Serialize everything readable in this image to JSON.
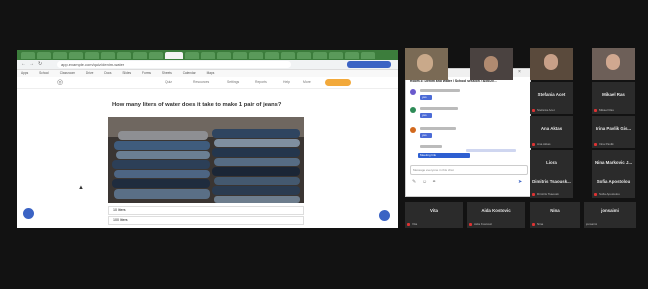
{
  "browser": {
    "url": "app.example.com/quiz/denim-water",
    "bookmarks": [
      "Apps",
      "School",
      "Classroom",
      "Drive",
      "Docs",
      "Slides",
      "Forms",
      "Sheets",
      "Calendar",
      "Maps"
    ],
    "nav_links": [
      "Quiz",
      "Resources",
      "Settings",
      "Reports",
      "Help",
      "More"
    ],
    "cta_label": ""
  },
  "quiz": {
    "question": "How many liters of water does it take to make 1 pair of jeans?",
    "answers": [
      "10 liters",
      "100 liters"
    ]
  },
  "chat": {
    "title": "Meeting chat",
    "subtitle": "Room 3: Denim and Water / School session / 8/26/20...",
    "bubbles": [
      "yes",
      "yes",
      "yes"
    ],
    "typed_message": "Meeting link",
    "input_placeholder": "Message everyone in this chat"
  },
  "participants": [
    {
      "name": "",
      "sub": "",
      "video": true,
      "muted": false
    },
    {
      "name": "",
      "sub": "",
      "video": true,
      "muted": false
    },
    {
      "name": "",
      "sub": "",
      "video": true,
      "muted": false
    },
    {
      "name": "",
      "sub": "",
      "video": true,
      "muted": false
    },
    {
      "name": "Stefania Acet",
      "sub": "Stefania Acet",
      "video": false,
      "muted": true
    },
    {
      "name": "Mikael Ras",
      "sub": "Mikael Ras",
      "video": false,
      "muted": true
    },
    {
      "name": "Ana Aktas",
      "sub": "Ana Aktas",
      "video": false,
      "muted": true
    },
    {
      "name": "Irina Pavlik Gis...",
      "sub": "Irina Pavlik",
      "video": false,
      "muted": true
    },
    {
      "name": "Liora",
      "sub": "Liora",
      "video": false,
      "muted": true
    },
    {
      "name": "Nina Markovic J...",
      "sub": "Nina Markovic",
      "video": false,
      "muted": true
    },
    {
      "name": "Dimitris Tsaousk...",
      "sub": "Dimitris Tsaousk",
      "video": false,
      "muted": true
    },
    {
      "name": "Sofia Apostolou",
      "sub": "Sofia Apostolou",
      "video": false,
      "muted": true
    },
    {
      "name": "Vita",
      "sub": "Vita",
      "video": false,
      "muted": true
    },
    {
      "name": "Aida Kostovic",
      "sub": "Aida Kostovic",
      "video": false,
      "muted": true
    },
    {
      "name": "Nina",
      "sub": "Nina",
      "video": false,
      "muted": true
    },
    {
      "name": "jonsaimi",
      "sub": "jonsaimi",
      "video": false,
      "muted": true
    }
  ],
  "colors": {
    "background": "#121212",
    "tab_bar": "#3c7d3c",
    "tile_bg": "#2b2b2b",
    "accent_blue": "#3b63c4",
    "cta_orange": "#f2a93b"
  }
}
